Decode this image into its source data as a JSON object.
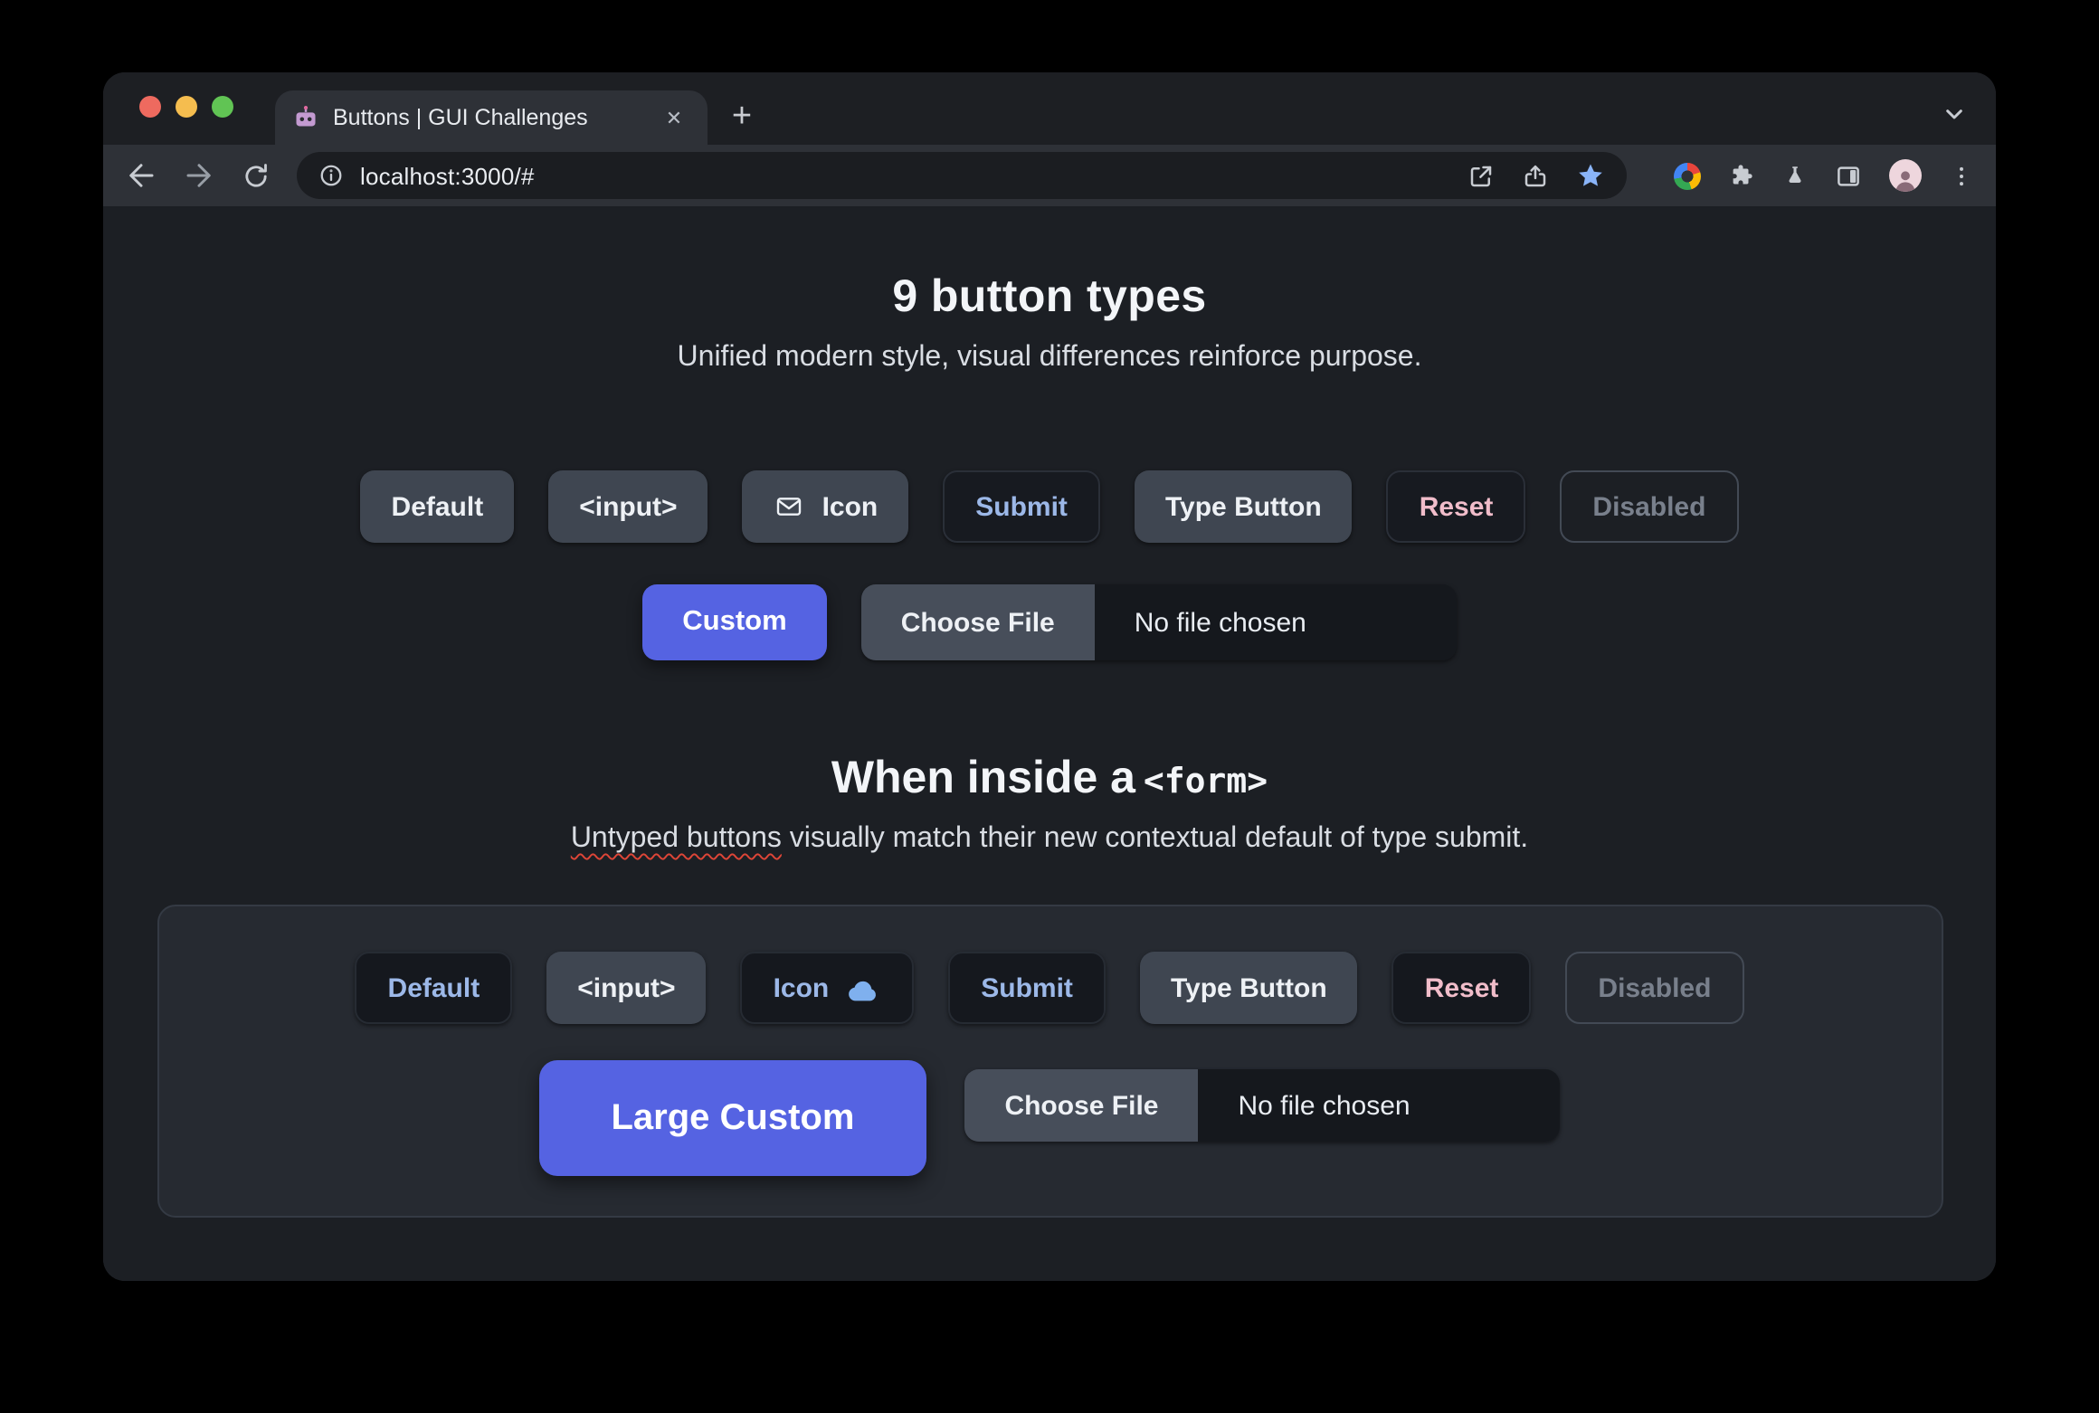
{
  "browser": {
    "tab_title": "Buttons | GUI Challenges",
    "close_tab_glyph": "✕",
    "new_tab_glyph": "+",
    "url": "localhost:3000/#"
  },
  "intro": {
    "heading": "9 button types",
    "subheading": "Unified modern style, visual differences reinforce purpose."
  },
  "row1": [
    {
      "label": "Default",
      "style": "gray"
    },
    {
      "label": "<input>",
      "style": "gray"
    },
    {
      "label": "Icon",
      "style": "gray",
      "icon": "envelope-icon"
    },
    {
      "label": "Submit",
      "style": "dark-blue"
    },
    {
      "label": "Type Button",
      "style": "gray"
    },
    {
      "label": "Reset",
      "style": "dark-pink"
    },
    {
      "label": "Disabled",
      "style": "disabled"
    }
  ],
  "custom_button": {
    "label": "Custom"
  },
  "file_input_1": {
    "button_label": "Choose File",
    "status": "No file chosen"
  },
  "form_section": {
    "heading_text": "When inside a",
    "heading_code": "<form>",
    "subheading_underlined": "Untyped buttons",
    "subheading_rest": " visually match their new contextual default of type submit.",
    "row": [
      {
        "label": "Default",
        "style": "dark-blue"
      },
      {
        "label": "<input>",
        "style": "gray"
      },
      {
        "label": "Icon",
        "style": "dark-blue",
        "icon": "cloud-icon"
      },
      {
        "label": "Submit",
        "style": "dark-blue"
      },
      {
        "label": "Type Button",
        "style": "gray"
      },
      {
        "label": "Reset",
        "style": "dark-pink"
      },
      {
        "label": "Disabled",
        "style": "disabled"
      }
    ],
    "large_custom_button": {
      "label": "Large Custom"
    },
    "file_input": {
      "button_label": "Choose File",
      "status": "No file chosen"
    }
  },
  "colors": {
    "accent_indigo": "#5563e2",
    "submit_text_blue": "#9cb8e8",
    "reset_text_pink": "#f1bdca",
    "bookmark_star_blue": "#8ab4f8",
    "spellcheck_red": "#de4537"
  }
}
